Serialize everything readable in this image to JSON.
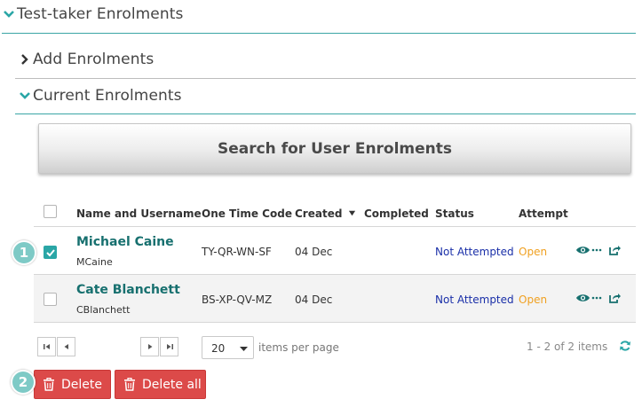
{
  "sections": {
    "test_taker": "Test-taker Enrolments",
    "add": "Add Enrolments",
    "current": "Current Enrolments"
  },
  "search_button": "Search for User Enrolments",
  "table": {
    "headers": {
      "name": "Name and Username",
      "code": "One Time Code",
      "created": "Created",
      "completed": "Completed",
      "status": "Status",
      "attempt": "Attempt"
    },
    "rows": [
      {
        "name": "Michael Caine",
        "username": "MCaine",
        "code": "TY-QR-WN-SF",
        "created": "04 Dec",
        "completed": "",
        "status": "Not Attempted",
        "attempt": "Open",
        "checked": true
      },
      {
        "name": "Cate Blanchett",
        "username": "CBlanchett",
        "code": "BS-XP-QV-MZ",
        "created": "04 Dec",
        "completed": "",
        "status": "Not Attempted",
        "attempt": "Open",
        "checked": false
      }
    ]
  },
  "pager": {
    "page_size": "20",
    "items_per_page": "items per page",
    "count": "1 - 2 of 2 items"
  },
  "buttons": {
    "delete": "Delete",
    "delete_all": "Delete all"
  },
  "callouts": {
    "one": "1",
    "two": "2"
  },
  "colors": {
    "teal": "#2aa6a6",
    "red": "#dc4a49",
    "status_blue": "#1a2fa8",
    "attempt_orange": "#f0a020"
  }
}
